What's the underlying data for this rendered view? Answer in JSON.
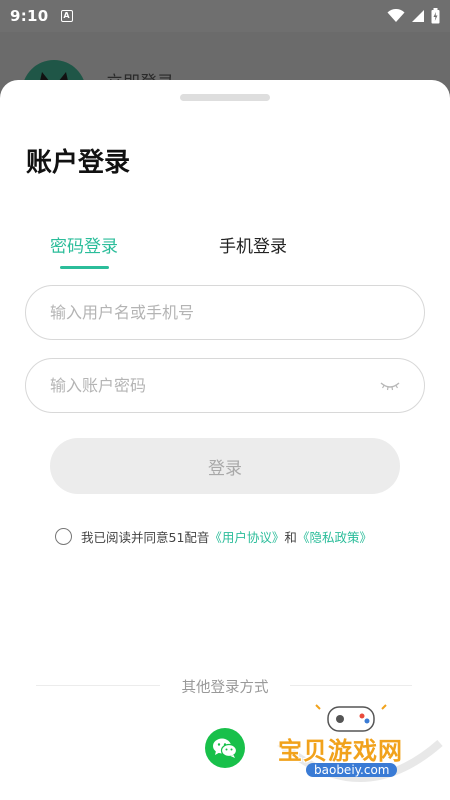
{
  "status_bar": {
    "time": "9:10",
    "notification_letter": "A"
  },
  "background": {
    "title": "立即登录"
  },
  "sheet": {
    "title": "账户登录",
    "tabs": [
      {
        "label": "密码登录",
        "active": true
      },
      {
        "label": "手机登录",
        "active": false
      }
    ],
    "username_placeholder": "输入用户名或手机号",
    "password_placeholder": "输入账户密码",
    "login_label": "登录",
    "agreement": {
      "prefix": "我已阅读并同意51配音",
      "user_agreement": "《用户协议》",
      "conjunction": "和",
      "privacy_policy": "《隐私政策》",
      "checked": false
    },
    "other_methods_label": "其他登录方式"
  },
  "watermark": {
    "text": "宝贝游戏网",
    "url": "baobeiy.com"
  },
  "colors": {
    "accent": "#2bbd9a",
    "wechat": "#18c04a",
    "button_disabled_bg": "#ececec"
  },
  "icons": [
    "wifi-icon",
    "signal-icon",
    "battery-icon",
    "eye-closed-icon",
    "wechat-icon"
  ]
}
